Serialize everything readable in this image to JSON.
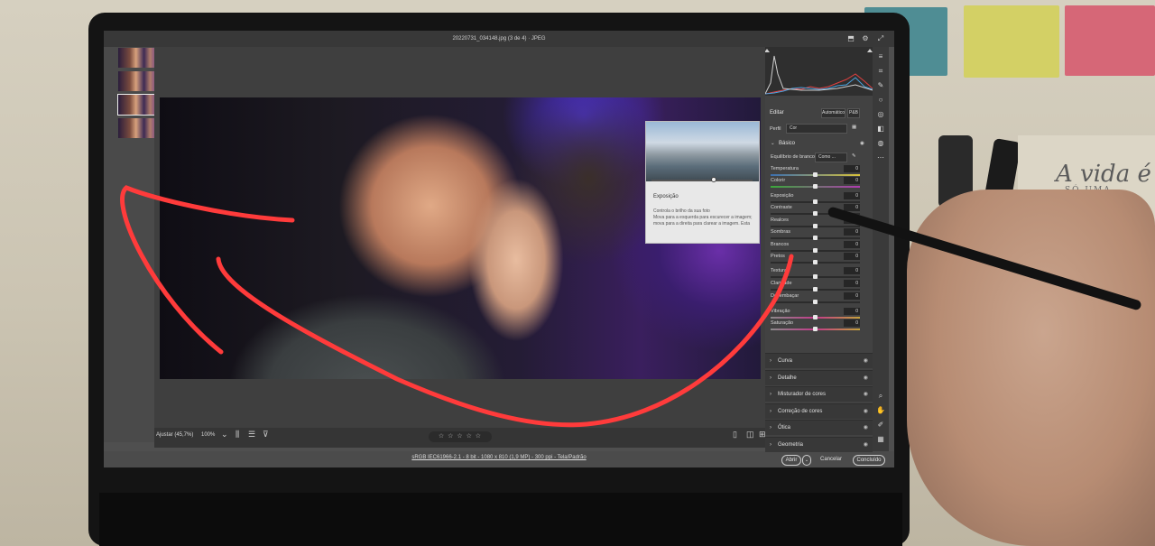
{
  "app": {
    "window_title": "20220731_034148.jpg (3 de 4)  ·  JPEG"
  },
  "filmstrip": {
    "thumbnails": [
      {
        "selected": false
      },
      {
        "selected": false
      },
      {
        "selected": true
      },
      {
        "selected": false
      }
    ]
  },
  "panel": {
    "header": {
      "title": "Editar",
      "auto_label": "Automático",
      "bw_label": "P&B"
    },
    "profile": {
      "label": "Perfil",
      "value": "Cor"
    },
    "basic": {
      "title": "Básico",
      "white_balance_label": "Equilíbrio de branco",
      "white_balance_value": "Como ...",
      "sliders": [
        {
          "label": "Temperatura",
          "value": "0"
        },
        {
          "label": "Colorir",
          "value": "0"
        },
        {
          "label": "Exposição",
          "value": "0"
        },
        {
          "label": "Contraste",
          "value": "0"
        },
        {
          "label": "Realces",
          "value": "0"
        },
        {
          "label": "Sombras",
          "value": "0"
        },
        {
          "label": "Brancos",
          "value": "0"
        },
        {
          "label": "Pretos",
          "value": "0"
        },
        {
          "label": "Textura",
          "value": "0"
        },
        {
          "label": "Claridade",
          "value": "0"
        },
        {
          "label": "Desembaçar",
          "value": "0"
        },
        {
          "label": "Vibração",
          "value": "0"
        },
        {
          "label": "Saturação",
          "value": "0"
        }
      ]
    },
    "sections": [
      "Curva",
      "Detalhe",
      "Misturador de cores",
      "Correção de cores",
      "Ótica",
      "Geometria"
    ]
  },
  "tooltip": {
    "title": "Exposição",
    "line1": "Controla o brilho da sua foto",
    "line2": "Mova para a esquerda para escurecer a imagem; mova para a direita para clarear a imagem. Esta"
  },
  "bottom_toolbar": {
    "zoom_fit": "Ajustar (45,7%)",
    "zoom_100": "100%",
    "rating": "☆ ☆ ☆ ☆ ☆"
  },
  "footer": {
    "file_info": "sRGB IEC61966-2.1 - 8 bit - 1080 x 810 (1,9 MP) - 300 ppi - Tela/Padrão",
    "open_label": "Abrir",
    "cancel_label": "Cancelar",
    "done_label": "Concluído"
  },
  "scene": {
    "postcard_text": "A vida é",
    "postcard_subtext": "SÓ UMA",
    "annotation_color": "#ff3b3b"
  }
}
